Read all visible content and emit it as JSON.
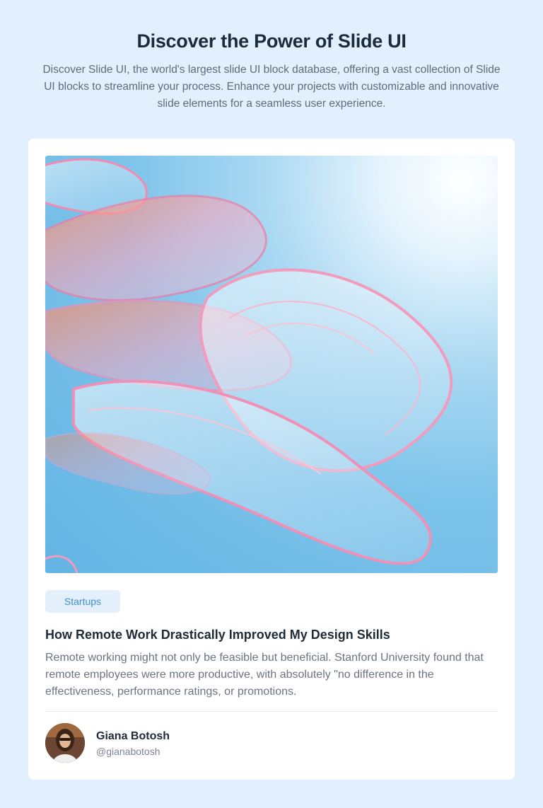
{
  "header": {
    "title": "Discover the Power of Slide UI",
    "subtitle": "Discover Slide UI, the world's largest slide UI block database, offering a vast collection of Slide UI blocks to streamline your process. Enhance your projects with customizable and innovative slide elements for a seamless user experience."
  },
  "post": {
    "tag": "Startups",
    "title": "How Remote Work Drastically Improved My Design Skills",
    "excerpt": "Remote working might not only be feasible but beneficial. Stanford University found that remote employees were more productive, with absolutely \"no difference in the effectiveness, performance ratings, or promotions.",
    "author": {
      "name": "Giana Botosh",
      "handle": "@gianabotosh"
    }
  },
  "colors": {
    "background": "#e2f0fd",
    "card": "#ffffff",
    "tag_bg": "#e3f0fc",
    "tag_text": "#3f8ecf",
    "title_text": "#1c2b3c"
  }
}
